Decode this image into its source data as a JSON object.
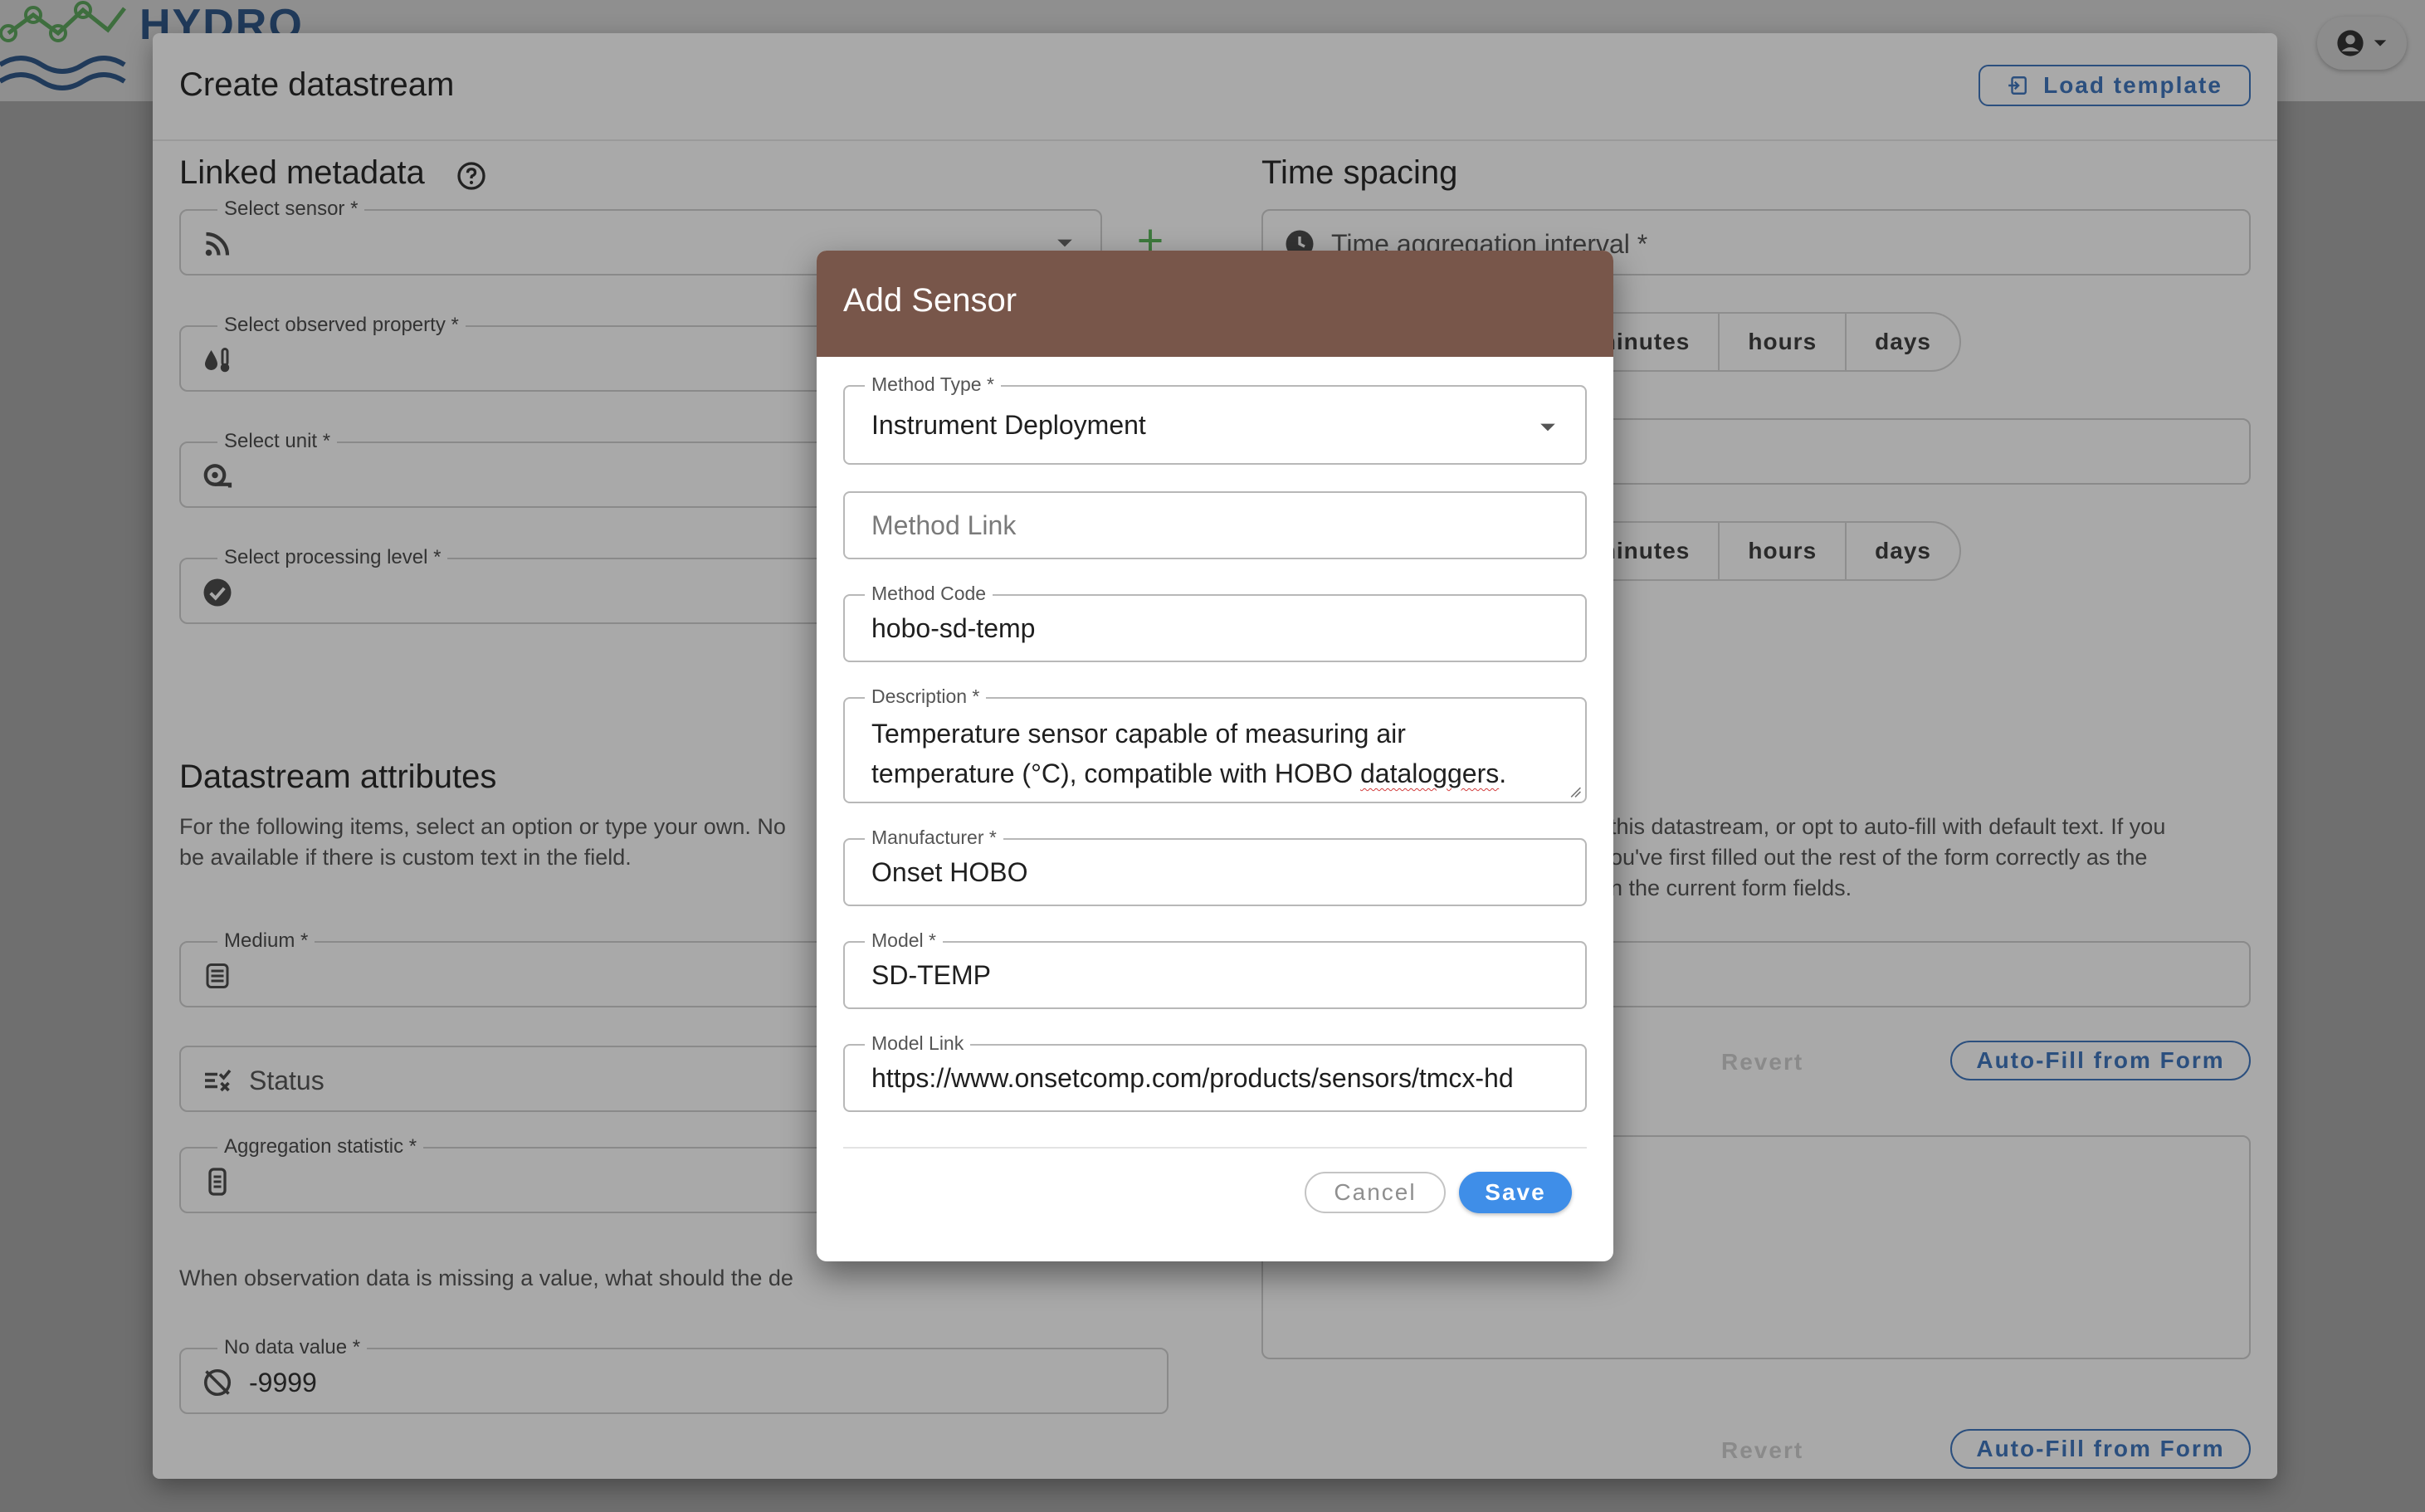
{
  "app": {
    "logo_text": "HYDRO"
  },
  "main_dialog": {
    "title": "Create datastream",
    "load_template_label": "Load template",
    "linked_metadata": {
      "title": "Linked metadata",
      "fields": {
        "sensor": {
          "label": "Select sensor *",
          "icon": "rss-icon"
        },
        "observed_property": {
          "label": "Select observed property *",
          "icon": "water-thermometer-icon"
        },
        "unit": {
          "label": "Select unit *",
          "icon": "tape-measure-icon"
        },
        "processing_level": {
          "label": "Select processing level *",
          "icon": "check-circle-icon"
        }
      }
    },
    "time_spacing": {
      "title": "Time spacing",
      "aggregation_interval_placeholder": "Time aggregation interval *",
      "units_row_1": [
        "minutes",
        "hours",
        "days"
      ],
      "units_row_2": [
        "minutes",
        "hours",
        "days"
      ]
    },
    "datastream_attributes": {
      "title": "Datastream attributes",
      "hint": "For the following items, select an option or type your own. No",
      "hint_line2": "be available if there is custom text in the field.",
      "medium_label": "Medium *",
      "status_placeholder": "Status",
      "aggregation_label": "Aggregation statistic *",
      "missing_hint": "When observation data is missing a value, what should the de",
      "no_data_label": "No data value *",
      "no_data_value": "-9999"
    },
    "description_section": {
      "hint_line1": "this datastream, or opt to auto-fill with default text. If you",
      "hint_line2": "ou've first filled out the rest of the form correctly as the",
      "hint_line3": "n the current form fields.",
      "revert_label_1": "Revert",
      "autofill_label_1": "Auto-Fill from Form",
      "revert_label_2": "Revert",
      "autofill_label_2": "Auto-Fill from Form"
    }
  },
  "add_sensor_modal": {
    "title": "Add Sensor",
    "method_type": {
      "label": "Method Type *",
      "value": "Instrument Deployment"
    },
    "method_link": {
      "placeholder": "Method Link"
    },
    "method_code": {
      "label": "Method Code",
      "value": "hobo-sd-temp"
    },
    "description": {
      "label": "Description *",
      "line1": "Temperature sensor capable of measuring air",
      "line2_a": "temperature (°C), compatible with HOBO ",
      "line2_b": "dataloggers",
      "line2_c": "."
    },
    "manufacturer": {
      "label": "Manufacturer *",
      "value": "Onset HOBO"
    },
    "model": {
      "label": "Model *",
      "value": "SD-TEMP"
    },
    "model_link": {
      "label": "Model Link",
      "value": "https://www.onsetcomp.com/products/sensors/tmcx-hd"
    },
    "cancel_label": "Cancel",
    "save_label": "Save",
    "colors": {
      "header": "#78564a",
      "save": "#3f8ee8"
    }
  }
}
